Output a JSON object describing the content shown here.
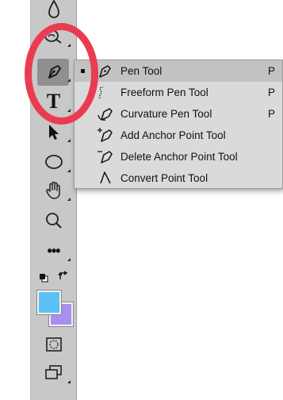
{
  "toolbar": {
    "tools": [
      {
        "name": "blur-tool"
      },
      {
        "name": "dodge-tool"
      },
      {
        "name": "pen-tool",
        "active": true
      },
      {
        "name": "type-tool",
        "glyph": "T"
      },
      {
        "name": "path-selection-tool"
      },
      {
        "name": "ellipse-tool"
      },
      {
        "name": "hand-tool"
      },
      {
        "name": "zoom-tool"
      },
      {
        "name": "edit-toolbar",
        "glyph": "•••"
      },
      {
        "name": "default-colors"
      },
      {
        "name": "quick-mask"
      },
      {
        "name": "screen-mode"
      }
    ],
    "foreground_color": "#5cc0f7",
    "background_color": "#a98ef2"
  },
  "pen_flyout": {
    "items": [
      {
        "label": "Pen Tool",
        "shortcut": "P",
        "selected": true,
        "icon": "pen-icon"
      },
      {
        "label": "Freeform Pen Tool",
        "shortcut": "P",
        "selected": false,
        "icon": "freeform-pen-icon"
      },
      {
        "label": "Curvature Pen Tool",
        "shortcut": "P",
        "selected": false,
        "icon": "curvature-pen-icon"
      },
      {
        "label": "Add Anchor Point Tool",
        "shortcut": "",
        "selected": false,
        "icon": "add-anchor-point-icon"
      },
      {
        "label": "Delete Anchor Point Tool",
        "shortcut": "",
        "selected": false,
        "icon": "delete-anchor-point-icon"
      },
      {
        "label": "Convert Point Tool",
        "shortcut": "",
        "selected": false,
        "icon": "convert-point-icon"
      }
    ]
  },
  "annotation": {
    "ring_color": "#ea3c51"
  }
}
